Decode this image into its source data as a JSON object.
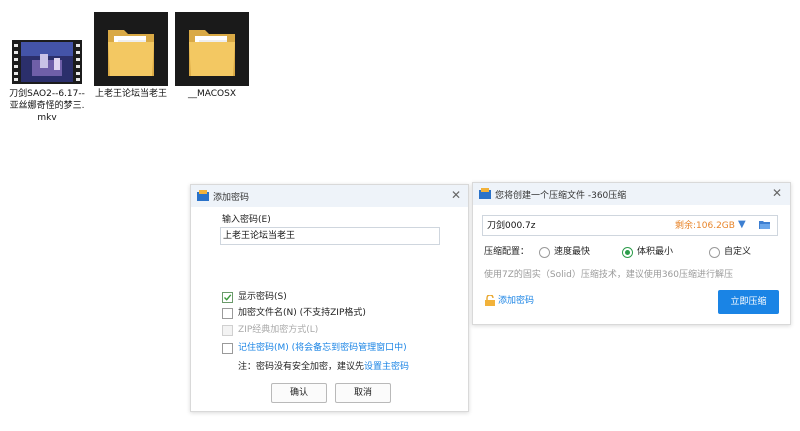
{
  "files": [
    {
      "label": "刀剑SAO2--6.17--亚丝娜奇怪的梦三.mkv",
      "icon": "video-file-icon"
    },
    {
      "label": "上老王论坛当老王",
      "icon": "folder-icon"
    },
    {
      "label": "__MACOSX",
      "icon": "folder-icon"
    }
  ],
  "password_dialog": {
    "title": "添加密码",
    "input_label": "输入密码(E)",
    "input_value": "上老王论坛当老王",
    "options": [
      {
        "label": "显示密码(S)",
        "checked": true,
        "disabled": false
      },
      {
        "label": "加密文件名(N) (不支持ZIP格式)",
        "checked": false,
        "disabled": false
      },
      {
        "label": "ZIP经典加密方式(L)",
        "checked": false,
        "disabled": true
      },
      {
        "label": "记住密码(M) (将会备忘到密码管理窗口中)",
        "checked": false,
        "disabled": false
      }
    ],
    "note_prefix": "注：密码没有安全加密，建议先",
    "note_link": "设置主密码",
    "ok_label": "确认",
    "cancel_label": "取消"
  },
  "compress_dialog": {
    "title": "您将创建一个压缩文件 -360压缩",
    "filename": "刀剑000.7z",
    "space_left": "剩余:106.2GB",
    "config_label": "压缩配置：",
    "modes": [
      {
        "label": "速度最快",
        "selected": false
      },
      {
        "label": "体积最小",
        "selected": true
      },
      {
        "label": "自定义",
        "selected": false
      }
    ],
    "hint": "使用7Z的固实（Solid）压缩技术，建议使用360压缩进行解压",
    "add_password_label": "添加密码",
    "compress_button": "立即压缩"
  },
  "colors": {
    "accent_blue": "#1a84e5",
    "orange": "#e8852a",
    "green": "#2c9c4a",
    "title_bar": "#eef3f9"
  }
}
